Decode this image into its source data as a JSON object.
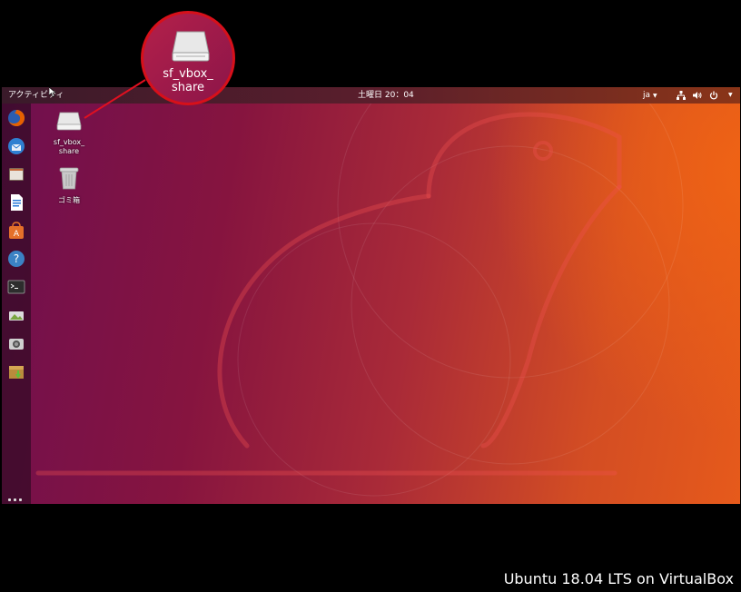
{
  "topbar": {
    "activities": "アクティビティ",
    "clock": "土曜日 20：04",
    "lang": "ja",
    "tray_icons": [
      "network-icon",
      "volume-icon",
      "power-icon"
    ]
  },
  "dock": {
    "items": [
      {
        "name": "firefox-icon",
        "color": "#e66000"
      },
      {
        "name": "thunderbird-icon",
        "color": "#2f7fd1"
      },
      {
        "name": "files-icon",
        "color": "#c46a3a"
      },
      {
        "name": "writer-icon",
        "color": "#2a7bd8"
      },
      {
        "name": "software-center-icon",
        "color": "#e4702a"
      },
      {
        "name": "help-icon",
        "color": "#3b82c4"
      },
      {
        "name": "terminal-icon",
        "color": "#2d2d2d"
      },
      {
        "name": "image-viewer-icon",
        "color": "#7aa640"
      },
      {
        "name": "screenshot-icon",
        "color": "#cfcfcf"
      },
      {
        "name": "archive-manager-icon",
        "color": "#b98b3c"
      }
    ],
    "show_apps": "show-applications-icon"
  },
  "desktop": {
    "icons": [
      {
        "name": "sf-vbox-share-icon",
        "label": "sf_vbox_\nshare"
      },
      {
        "name": "trash-icon",
        "label": "ゴミ箱"
      }
    ]
  },
  "callout": {
    "label_line1": "sf_vbox_",
    "label_line2": "share",
    "border_color": "#d7101a"
  },
  "caption": "Ubuntu 18.04 LTS on VirtualBox"
}
